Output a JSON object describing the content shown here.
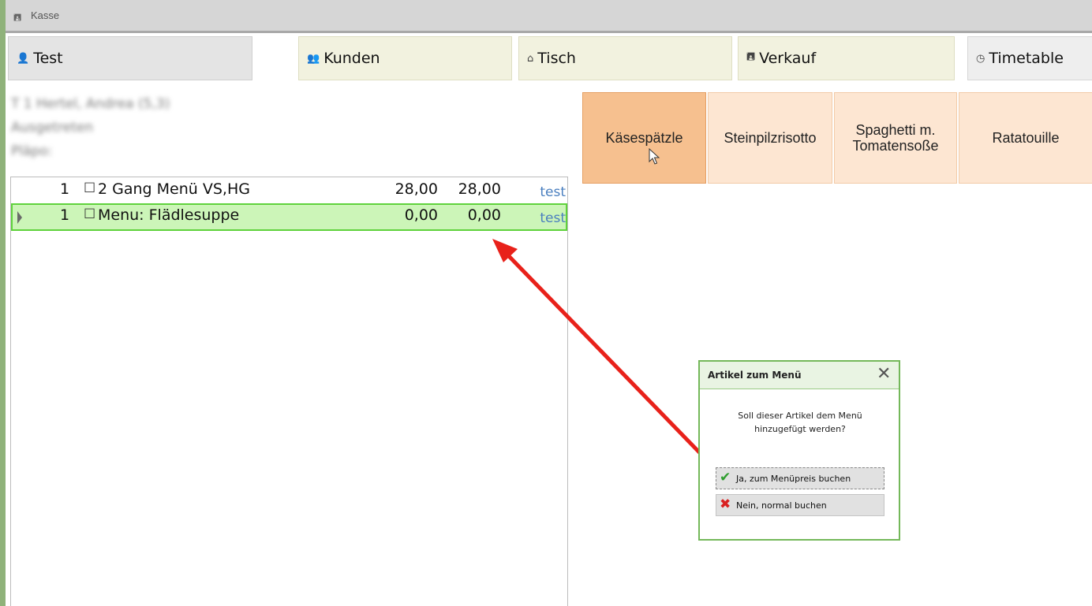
{
  "window": {
    "title": "Kasse"
  },
  "tabs": {
    "test": "Test",
    "kunden": "Kunden",
    "tisch": "Tisch",
    "verkauf": "Verkauf",
    "timetable": "Timetable"
  },
  "guest_info": {
    "line1": "T 1 Hertel, Andrea (5,3)",
    "line2": "Ausgetreten",
    "line3": "Pläpo:"
  },
  "order": {
    "rows": [
      {
        "qty": "1",
        "name": "2 Gang Menü VS,HG",
        "price": "28,00",
        "total": "28,00",
        "tag": "test"
      },
      {
        "qty": "1",
        "name": "Menu: Flädlesuppe",
        "price": "0,00",
        "total": "0,00",
        "tag": "test"
      }
    ]
  },
  "items": {
    "item1": "Käsespätzle",
    "item2": "Steinpilzrisotto",
    "item3_line1": "Spaghetti m.",
    "item3_line2": "Tomatensoße",
    "item4": "Ratatouille"
  },
  "dialog": {
    "title": "Artikel zum Menü",
    "message_line1": "Soll dieser Artikel dem Menü",
    "message_line2": "hinzugefügt werden?",
    "btn_yes": "Ja, zum Menüpreis buchen",
    "btn_no": "Nein, normal buchen"
  },
  "colors": {
    "accent_green": "#5fd23c",
    "selected_item": "#f6c08f",
    "arrow": "#e8211a"
  },
  "icons": [
    "register-icon",
    "user-icon",
    "customers-icon",
    "home-icon",
    "register-icon",
    "clock-icon",
    "checkbox-icon",
    "checkmark-icon",
    "cross-icon",
    "close-icon",
    "mouse-pointer-icon"
  ]
}
